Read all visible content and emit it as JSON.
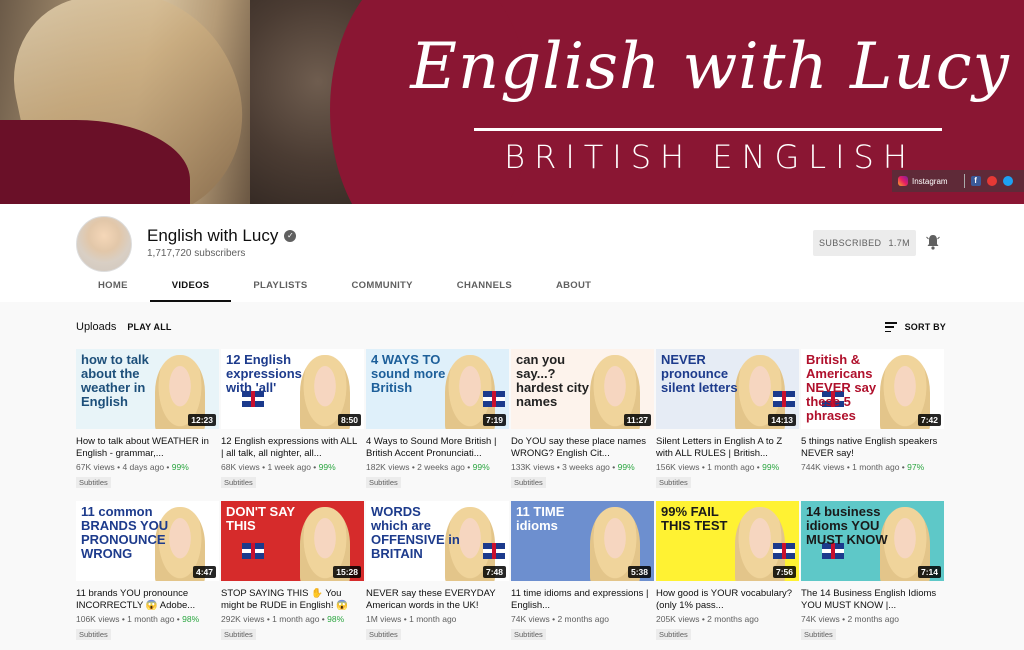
{
  "banner": {
    "title": "English with Lucy",
    "subtitle": "BRITISH ENGLISH",
    "social_instagram": "Instagram",
    "social_facebook": "f"
  },
  "channel": {
    "name": "English with Lucy",
    "verified_mark": "✓",
    "subscribers": "1,717,720 subscribers",
    "subscribe_label": "SUBSCRIBED",
    "subscribe_count": "1.7M"
  },
  "tabs": [
    {
      "label": "HOME",
      "active": false
    },
    {
      "label": "VIDEOS",
      "active": true
    },
    {
      "label": "PLAYLISTS",
      "active": false
    },
    {
      "label": "COMMUNITY",
      "active": false
    },
    {
      "label": "CHANNELS",
      "active": false
    },
    {
      "label": "ABOUT",
      "active": false
    }
  ],
  "uploads": {
    "title": "Uploads",
    "play_all": "PLAY ALL",
    "sort_by": "SORT BY"
  },
  "videos": [
    {
      "thumb_text": "how to talk about the weather in English",
      "thumb_bg": "#e8f4f8",
      "thumb_color": "#1d4f7a",
      "duration": "12:23",
      "title": "How to talk about WEATHER in English - grammar,...",
      "views": "67K views",
      "age": "4 days ago",
      "rating": "99%",
      "badge": "Subtitles"
    },
    {
      "thumb_text": "12 English expressions with 'all'",
      "thumb_bg": "#ffffff",
      "thumb_color": "#1d3b8c",
      "duration": "8:50",
      "title": "12 English expressions with ALL | all talk, all nighter, all...",
      "views": "68K views",
      "age": "1 week ago",
      "rating": "99%",
      "badge": "Subtitles"
    },
    {
      "thumb_text": "4 WAYS TO sound more British",
      "thumb_bg": "#dff0fa",
      "thumb_color": "#1d5f9a",
      "duration": "7:19",
      "title": "4 Ways to Sound More British | British Accent Pronunciati...",
      "views": "182K views",
      "age": "2 weeks ago",
      "rating": "99%",
      "badge": "Subtitles"
    },
    {
      "thumb_text": "can you say...? hardest city names",
      "thumb_bg": "#fdf3ec",
      "thumb_color": "#222222",
      "duration": "11:27",
      "title": "Do YOU say these place names WRONG? English Cit...",
      "views": "133K views",
      "age": "3 weeks ago",
      "rating": "99%",
      "badge": "Subtitles"
    },
    {
      "thumb_text": "NEVER pronounce silent letters",
      "thumb_bg": "#e6ecf5",
      "thumb_color": "#1d3b8c",
      "duration": "14:13",
      "title": "Silent Letters in English A to Z with ALL RULES | British...",
      "views": "156K views",
      "age": "1 month ago",
      "rating": "99%",
      "badge": "Subtitles"
    },
    {
      "thumb_text": "British & Americans NEVER say these 5 phrases",
      "thumb_bg": "#ffffff",
      "thumb_color": "#b0102c",
      "duration": "7:42",
      "title": "5 things native English speakers NEVER say!",
      "views": "744K views",
      "age": "1 month ago",
      "rating": "97%",
      "badge": ""
    },
    {
      "thumb_text": "11 common BRANDS YOU PRONOUNCE WRONG",
      "thumb_bg": "#ffffff",
      "thumb_color": "#1d3b8c",
      "duration": "4:47",
      "title": "11 brands YOU pronounce INCORRECTLY 😱 Adobe...",
      "views": "106K views",
      "age": "1 month ago",
      "rating": "98%",
      "badge": "Subtitles"
    },
    {
      "thumb_text": "DON'T SAY THIS",
      "thumb_bg": "#d62b2b",
      "thumb_color": "#ffffff",
      "duration": "15:28",
      "title": "STOP SAYING THIS ✋ You might be RUDE in English! 😱",
      "views": "292K views",
      "age": "1 month ago",
      "rating": "98%",
      "badge": "Subtitles"
    },
    {
      "thumb_text": "WORDS which are OFFENSIVE in BRITAIN",
      "thumb_bg": "#ffffff",
      "thumb_color": "#1d3b8c",
      "duration": "7:48",
      "title": "NEVER say these EVERYDAY American words in the UK!",
      "views": "1M views",
      "age": "1 month ago",
      "rating": "",
      "badge": "Subtitles"
    },
    {
      "thumb_text": "11 TIME idioms",
      "thumb_bg": "#6d8fcf",
      "thumb_color": "#ffffff",
      "duration": "5:38",
      "title": "11 time idioms and expressions | English...",
      "views": "74K views",
      "age": "2 months ago",
      "rating": "",
      "badge": "Subtitles"
    },
    {
      "thumb_text": "99% FAIL THIS TEST",
      "thumb_bg": "#fff233",
      "thumb_color": "#1a1a1a",
      "duration": "7:56",
      "title": "How good is YOUR vocabulary? (only 1% pass...",
      "views": "205K views",
      "age": "2 months ago",
      "rating": "",
      "badge": "Subtitles"
    },
    {
      "thumb_text": "14 business idioms YOU MUST KNOW",
      "thumb_bg": "#5ec8c8",
      "thumb_color": "#1a1a1a",
      "duration": "7:14",
      "title": "The 14 Business English Idioms YOU MUST KNOW |...",
      "views": "74K views",
      "age": "2 months ago",
      "rating": "",
      "badge": "Subtitles"
    }
  ],
  "colors": {
    "banner": "#8a1633",
    "rating_green": "#2ba640",
    "meta_gray": "#606060"
  }
}
